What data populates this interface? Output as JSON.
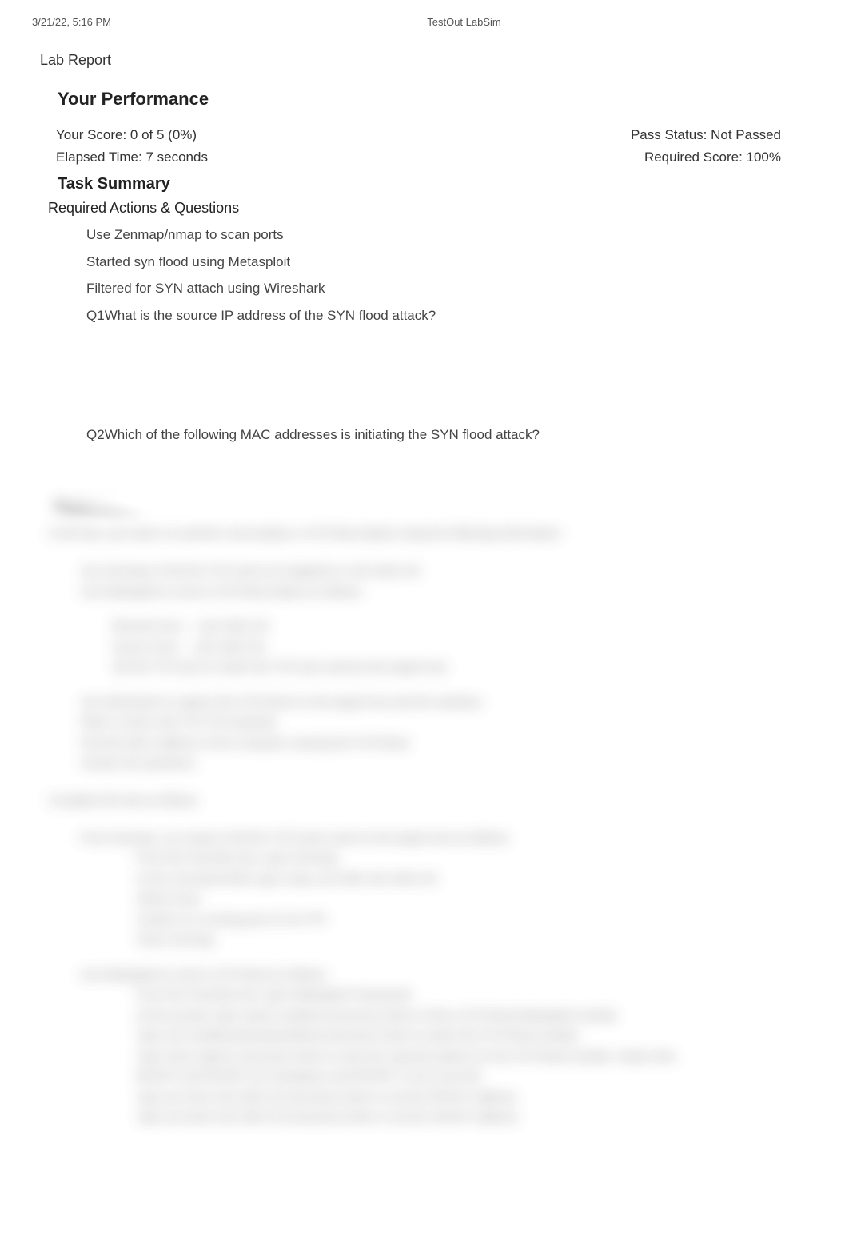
{
  "header": {
    "timestamp": "3/21/22, 5:16 PM",
    "app_title": "TestOut LabSim"
  },
  "report": {
    "title": "Lab Report",
    "performance_heading": "Your Performance",
    "score_label": "Your Score: 0 of 5 (0%)",
    "pass_status": "Pass Status: Not Passed",
    "elapsed": "Elapsed Time: 7 seconds",
    "required_score": "Required Score: 100%",
    "task_heading": "Task Summary",
    "required_heading": "Required Actions & Questions",
    "actions": [
      "Use Zenmap/nmap to scan ports",
      "Started syn flood using Metasploit",
      "Filtered for SYN attach using Wireshark"
    ],
    "questions": [
      {
        "label": "Q1",
        "text": "What is the source IP address of the SYN flood attack?"
      },
      {
        "label": "Q2",
        "text": "Which of the following MAC addresses is initiating the SYN flood attack?"
      }
    ]
  },
  "explanation": {
    "heading": "Explanation",
    "intro": "In this lab, your task is to perform and analyze a SYN flood attack using the following information:",
    "bullets_a": [
      "Use Zenmap to find the TCP ports are targeted on 192.168.0.45.",
      "Use Metasploit to send a SYN flood attack as follows:"
    ],
    "params": [
      "Remote host — 192.168.0.45",
      "Source host — 192.168.0.33",
      "Set the TCP port to match the TCP port used by the target host."
    ],
    "bullets_b": [
      "Use Wireshark to capture the SYN flood on the target host and the interface.",
      "Filter to show only TCP SYN packets.",
      "Find the MAC address of the computer causing the SYN flood.",
      "Answer the questions."
    ],
    "complete": "Complete this lab as follows:",
    "steps1_head": "From Zenmap, run nmap to find the TCP ports used on the target host as follows:",
    "steps1": [
      "From the Favorites bar, open Zenmap.",
      "In the Command field, type nmap -p0-1000 192.168.0.45",
      "Select Scan.",
      "Confirm it is running port 21 for FTP.",
      "Close Zenmap."
    ],
    "steps2_head": "Use Metasploit to send a SYN flood as follows:",
    "steps2": [
      "From the Favorites bar, open Metasploit Framework.",
      "At the prompt, type search synflood and press Enter to find a SYN flood Metasploit module.",
      "Type use auxiliary/dos/tcp/synflood and press Enter to select the SYN flood module.",
      "Type show options and press Enter to view the required options for the SYN flood module. Notice that RHOST and RPORT are mandatory and RPORT is set to port 80.",
      "Type set rhost 192.168.0.45 and press Enter to set the RHOST address.",
      "Type set shost 192.168.0.33 and press Enter to set the SHOST address."
    ]
  }
}
